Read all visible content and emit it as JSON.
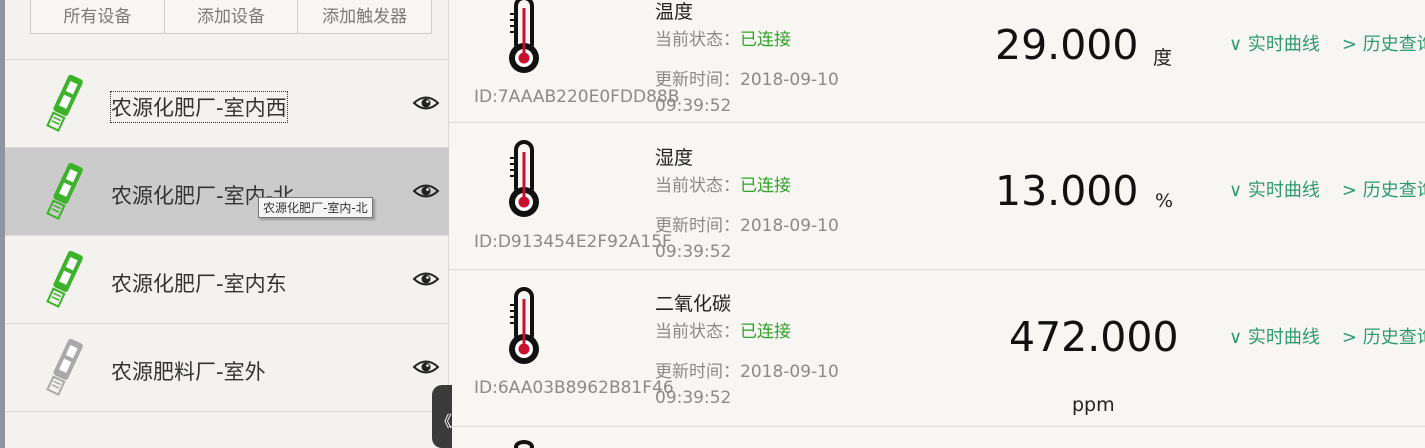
{
  "tabs": [
    "所有设备",
    "添加设备",
    "添加触发器"
  ],
  "devices": [
    {
      "name": "农源化肥厂-室内西",
      "icon": "green-device-icon",
      "color": "#3cb22a"
    },
    {
      "name": "农源化肥厂-室内-北",
      "icon": "green-device-icon",
      "color": "#3cb22a"
    },
    {
      "name": "农源化肥厂-室内东",
      "icon": "green-device-icon",
      "color": "#3cb22a"
    },
    {
      "name": "农源肥料厂-室外",
      "icon": "gray-device-icon",
      "color": "#a9a9a9"
    }
  ],
  "tooltip": "农源化肥厂-室内-北",
  "collapse_glyph": "《",
  "sensors": [
    {
      "name": "温度",
      "status_label": "当前状态：",
      "status": "已连接",
      "time_label": "更新时间：2018-09-10 09:39:52",
      "id": "ID:7AAAB220E0FDD88B",
      "value": "29.000",
      "unit": "度"
    },
    {
      "name": "湿度",
      "status_label": "当前状态：",
      "status": "已连接",
      "time_label": "更新时间：2018-09-10 09:39:52",
      "id": "ID:D913454E2F92A15F",
      "value": "13.000",
      "unit": "%"
    },
    {
      "name": "二氧化碳",
      "status_label": "当前状态：",
      "status": "已连接",
      "time_label": "更新时间：2018-09-10 09:39:52",
      "id": "ID:6AA03B8962B81F46",
      "value": "472.000",
      "unit": "ppm"
    }
  ],
  "links": {
    "realtime": "∨ 实时曲线",
    "history": "> 历史查询"
  },
  "colors": {
    "connected": "#32a02a",
    "link": "#2e9a6e",
    "thermo_red": "#c8102e"
  }
}
